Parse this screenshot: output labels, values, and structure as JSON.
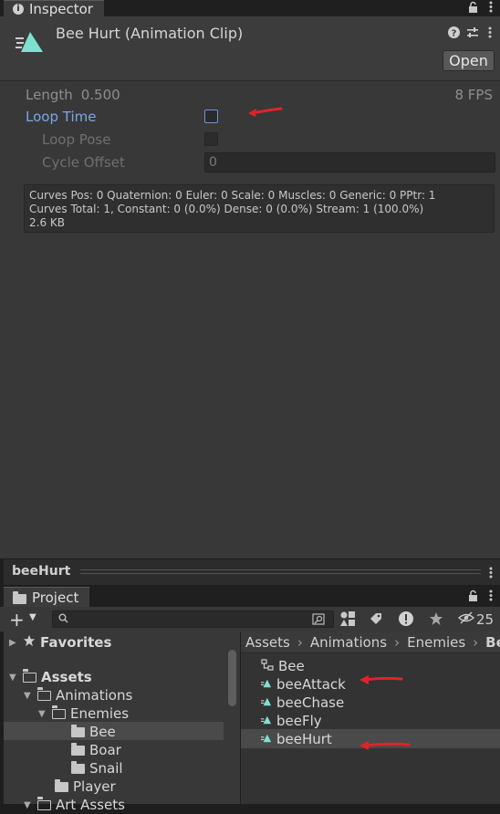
{
  "inspector": {
    "tab_label": "Inspector",
    "title": "Bee Hurt (Animation Clip)",
    "open_button": "Open",
    "length_label": "Length",
    "length_value": "0.500",
    "fps": "8 FPS",
    "loop_time_label": "Loop Time",
    "loop_time_checked": false,
    "loop_pose_label": "Loop Pose",
    "cycle_offset_label": "Cycle Offset",
    "cycle_offset_value": "0",
    "info_line1": "Curves Pos: 0 Quaternion: 0 Euler: 0 Scale: 0 Muscles: 0 Generic: 0 PPtr: 1",
    "info_line2": "Curves Total: 1, Constant: 0 (0.0%) Dense: 0 (0.0%) Stream: 1 (100.0%)",
    "info_line3": "2.6 KB",
    "footer_name": "beeHurt"
  },
  "project": {
    "tab_label": "Project",
    "hidden_count": "25",
    "tree": {
      "favorites": "Favorites",
      "assets": "Assets",
      "animations": "Animations",
      "enemies": "Enemies",
      "bee": "Bee",
      "boar": "Boar",
      "snail": "Snail",
      "player": "Player",
      "art_assets": "Art Assets"
    },
    "breadcrumb": [
      "Assets",
      "Animations",
      "Enemies",
      "Bee"
    ],
    "files": [
      {
        "name": "Bee",
        "type": "animator"
      },
      {
        "name": "beeAttack",
        "type": "clip"
      },
      {
        "name": "beeChase",
        "type": "clip"
      },
      {
        "name": "beeFly",
        "type": "clip"
      },
      {
        "name": "beeHurt",
        "type": "clip"
      }
    ]
  },
  "colors": {
    "accent_blue": "#7aa6e8",
    "annotation_red": "#e0232b",
    "clip_icon": "#7ee0d0",
    "selection": "#4a4a4a"
  }
}
